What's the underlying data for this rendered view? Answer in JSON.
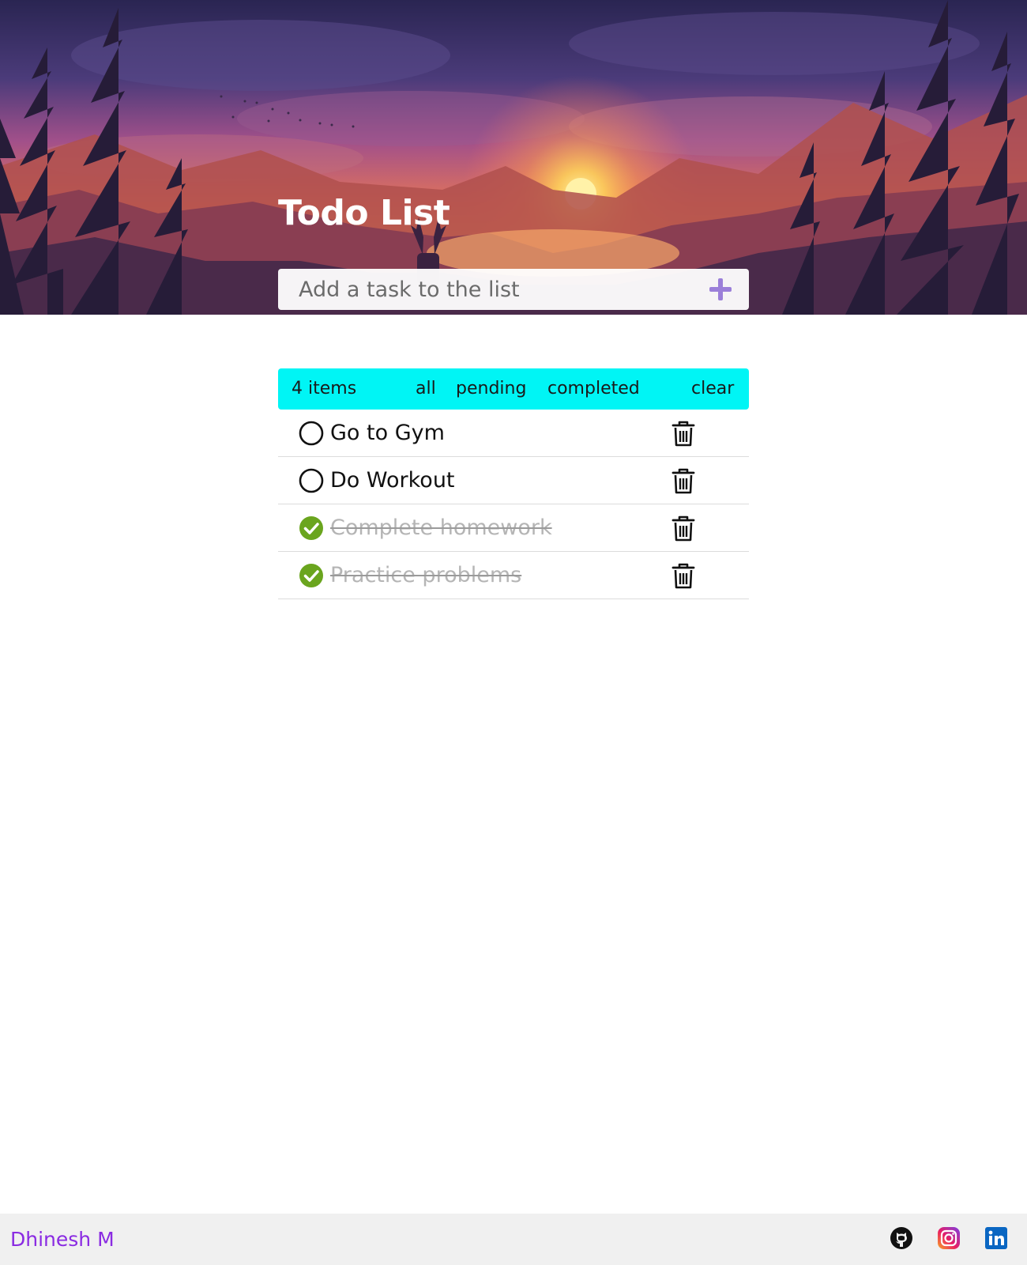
{
  "header": {
    "title": "Todo List",
    "input_placeholder": "Add a task to the list",
    "add_icon": "plus-icon"
  },
  "filters": {
    "count_label": "4 items",
    "all_label": "all",
    "pending_label": "pending",
    "completed_label": "completed",
    "clear_label": "clear"
  },
  "tasks": [
    {
      "text": "Go to Gym",
      "completed": false
    },
    {
      "text": "Do Workout",
      "completed": false
    },
    {
      "text": "Complete homework",
      "completed": true
    },
    {
      "text": "Practice problems",
      "completed": true
    }
  ],
  "footer": {
    "author": "Dhinesh M",
    "links": [
      "github-icon",
      "instagram-icon",
      "linkedin-icon"
    ]
  },
  "colors": {
    "filter_bar": "#00f5f5",
    "accent_plus": "#9b7fd9",
    "check_done": "#6aa51e",
    "author": "#8a2be2",
    "footer_bg": "#f0f0f0"
  }
}
